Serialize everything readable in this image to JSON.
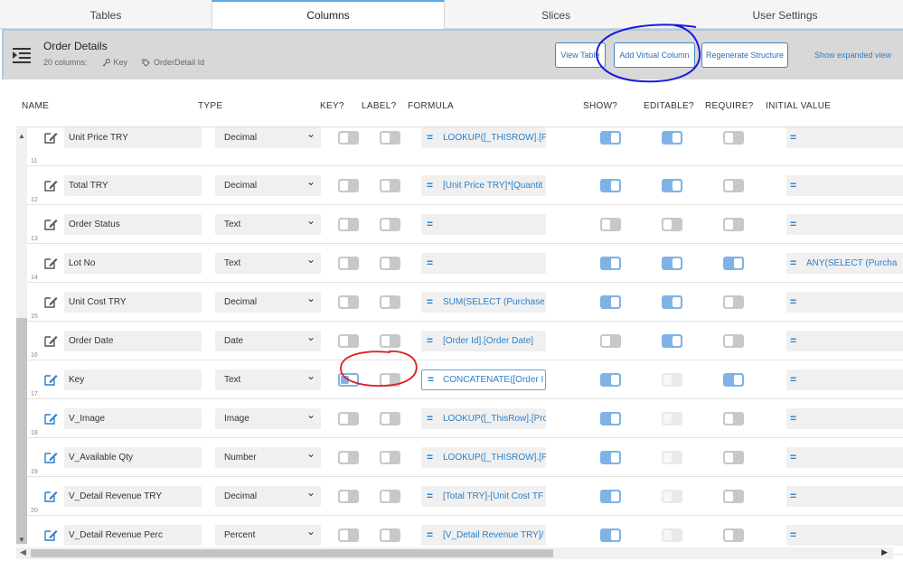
{
  "tabs": [
    {
      "label": "Tables",
      "active": false
    },
    {
      "label": "Columns",
      "active": true
    },
    {
      "label": "Slices",
      "active": false
    },
    {
      "label": "User Settings",
      "active": false
    }
  ],
  "header": {
    "title": "Order Details",
    "column_count": "20 columns:",
    "key_label": "Key",
    "label_label": "OrderDetail Id",
    "buttons": {
      "view_table": "View Table",
      "add_virtual_column": "Add Virtual Column",
      "regenerate_structure": "Regenerate Structure"
    },
    "expanded_link": "Show expanded view"
  },
  "columns": {
    "name": "NAME",
    "type": "TYPE",
    "key": "KEY?",
    "label": "LABEL?",
    "formula": "FORMULA",
    "show": "SHOW?",
    "editable": "EDITABLE?",
    "require": "REQUIRE?",
    "initial_value": "INITIAL VALUE"
  },
  "rows": [
    {
      "num": "",
      "name": "Unit Price TRY",
      "type": "Decimal",
      "key": "off",
      "label": "off",
      "formula": "LOOKUP([_THISROW].[P",
      "show": "on",
      "editable": "on",
      "require": "off",
      "initial": ""
    },
    {
      "num": "11",
      "name": "Total TRY",
      "type": "Decimal",
      "key": "off",
      "label": "off",
      "formula": "[Unit Price TRY]*[Quantit",
      "show": "on",
      "editable": "on",
      "require": "off",
      "initial": ""
    },
    {
      "num": "12",
      "name": "Order Status",
      "type": "Text",
      "key": "off",
      "label": "off",
      "formula": "",
      "show": "off",
      "editable": "off",
      "require": "off",
      "initial": ""
    },
    {
      "num": "13",
      "name": "Lot No",
      "type": "Text",
      "key": "off",
      "label": "off",
      "formula": "",
      "show": "on",
      "editable": "on",
      "require": "on",
      "initial": "ANY(SELECT (Purcha"
    },
    {
      "num": "14",
      "name": "Unit Cost TRY",
      "type": "Decimal",
      "key": "off",
      "label": "off",
      "formula": "SUM(SELECT (Purchase",
      "show": "on",
      "editable": "on",
      "require": "off",
      "initial": ""
    },
    {
      "num": "15",
      "name": "Order Date",
      "type": "Date",
      "key": "off",
      "label": "off",
      "formula": "[Order Id].[Order Date]",
      "show": "off",
      "editable": "on",
      "require": "off",
      "initial": ""
    },
    {
      "num": "16",
      "name": "Key",
      "type": "Text",
      "key": "key-on",
      "label": "off",
      "formula": "CONCATENATE([Order I",
      "show": "on",
      "editable": "disabled",
      "require": "on",
      "initial": ""
    },
    {
      "num": "17",
      "name": "V_Image",
      "type": "Image",
      "key": "off",
      "label": "off",
      "formula": "LOOKUP([_ThisRow].[Pro",
      "show": "on",
      "editable": "disabled",
      "require": "off",
      "initial": ""
    },
    {
      "num": "18",
      "name": "V_Available Qty",
      "type": "Number",
      "key": "off",
      "label": "off",
      "formula": "LOOKUP([_THISROW].[P",
      "show": "on",
      "editable": "disabled",
      "require": "off",
      "initial": ""
    },
    {
      "num": "19",
      "name": "V_Detail Revenue TRY",
      "type": "Decimal",
      "key": "off",
      "label": "off",
      "formula": "[Total TRY]-[Unit Cost TF",
      "show": "on",
      "editable": "disabled",
      "require": "off",
      "initial": ""
    },
    {
      "num": "20",
      "name": "V_Detail Revenue Perc",
      "type": "Percent",
      "key": "off",
      "label": "off",
      "formula": "[V_Detail Revenue TRY]/",
      "show": "on",
      "editable": "disabled",
      "require": "off",
      "initial": ""
    }
  ],
  "colors": {
    "accent": "#2a7fc9",
    "toggle_on": "#7fb3e6",
    "annotation_blue": "#1a1adb",
    "annotation_red": "#e02020"
  }
}
